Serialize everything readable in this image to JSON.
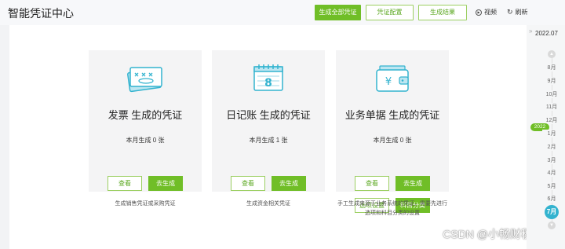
{
  "header": {
    "title": "智能凭证中心",
    "buttons": [
      "生成全部凭证",
      "凭证配置",
      "生成结果"
    ],
    "video_label": "视频",
    "refresh_label": "刷新"
  },
  "cards": [
    {
      "title": "发票 生成的凭证",
      "count_text": "本月生成 0 张",
      "view_label": "查看",
      "generate_label": "去生成",
      "desc": "生成销售凭证或采购凭证"
    },
    {
      "title": "日记账 生成的凭证",
      "count_text": "本月生成 1 张",
      "view_label": "查看",
      "generate_label": "去生成",
      "desc": "生成资金相关凭证"
    },
    {
      "title": "业务单据 生成的凭证",
      "count_text": "本月生成 0 张",
      "view_label": "查看",
      "generate_label": "去生成",
      "options_label": "选项设置",
      "category_label": "科目分类",
      "desc_line1": "手工生成来源于业务系统的凭证，需要先进行",
      "desc_line2": "选项和科目分类的设置"
    }
  ],
  "timeline": {
    "current": "2022.07",
    "year_badge": "2022",
    "months_before": [
      "8月",
      "9月",
      "10月",
      "11月",
      "12月"
    ],
    "months_after": [
      "1月",
      "2月",
      "3月",
      "4月",
      "5月",
      "6月"
    ],
    "active_month": "7月"
  },
  "watermark": "CSDN @小畅财税笔记",
  "colors": {
    "accent": "#70be27",
    "icon": "#33b3cf",
    "active_month": "#33b3cf"
  }
}
